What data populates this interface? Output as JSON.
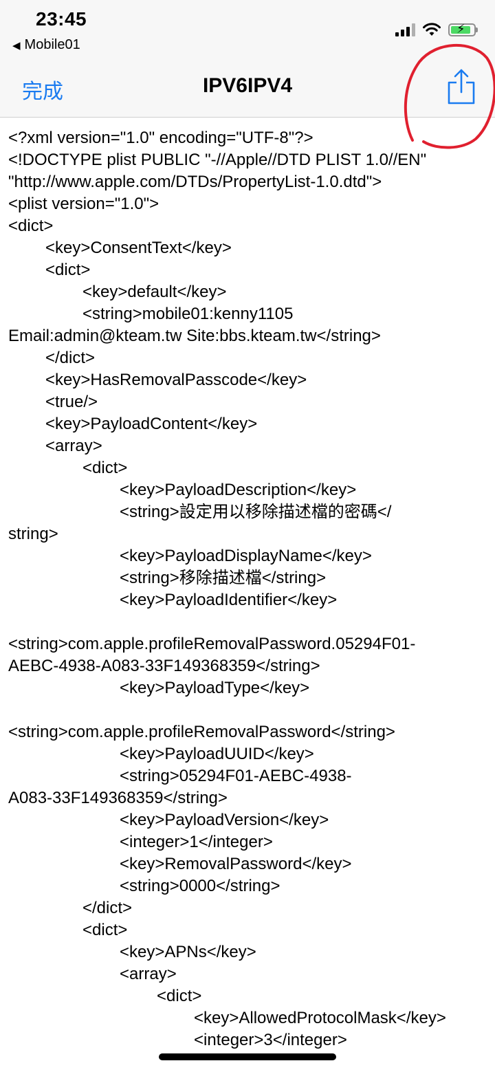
{
  "status_bar": {
    "time": "23:45",
    "back_app": "Mobile01",
    "back_icon": "back-triangle",
    "signal_icon": "cellular-signal",
    "wifi_icon": "wifi",
    "battery_icon": "battery-charging"
  },
  "nav": {
    "done_label": "完成",
    "title": "IPV6IPV4",
    "share_icon": "share-icon",
    "accent_color": "#1a7bf0",
    "annotation_color": "#e0202f"
  },
  "content": {
    "lines": [
      "<?xml version=\"1.0\" encoding=\"UTF-8\"?>",
      "<!DOCTYPE plist PUBLIC \"-//Apple//DTD PLIST 1.0//EN\"",
      "\"http://www.apple.com/DTDs/PropertyList-1.0.dtd\">",
      "<plist version=\"1.0\">",
      "<dict>",
      "<key>ConsentText</key>",
      "<dict>",
      "<key>default</key>",
      "<string>mobile01:kenny1105",
      "Email:admin@kteam.tw Site:bbs.kteam.tw</string>",
      "</dict>",
      "<key>HasRemovalPasscode</key>",
      "<true/>",
      "<key>PayloadContent</key>",
      "<array>",
      "<dict>",
      "<key>PayloadDescription</key>",
      "<string>設定用以移除描述檔的密碼</",
      "string>",
      "<key>PayloadDisplayName</key>",
      "<string>移除描述檔</string>",
      "<key>PayloadIdentifier</key>",
      "",
      "<string>com.apple.profileRemovalPassword.05294F01-",
      "AEBC-4938-A083-33F149368359</string>",
      "<key>PayloadType</key>",
      "",
      "<string>com.apple.profileRemovalPassword</string>",
      "<key>PayloadUUID</key>",
      "<string>05294F01-AEBC-4938-",
      "A083-33F149368359</string>",
      "<key>PayloadVersion</key>",
      "<integer>1</integer>",
      "<key>RemovalPassword</key>",
      "<string>0000</string>",
      "</dict>",
      "<dict>",
      "<key>APNs</key>",
      "<array>",
      "<dict>",
      "<key>AllowedProtocolMask</key>",
      "<integer>3</integer>"
    ]
  }
}
